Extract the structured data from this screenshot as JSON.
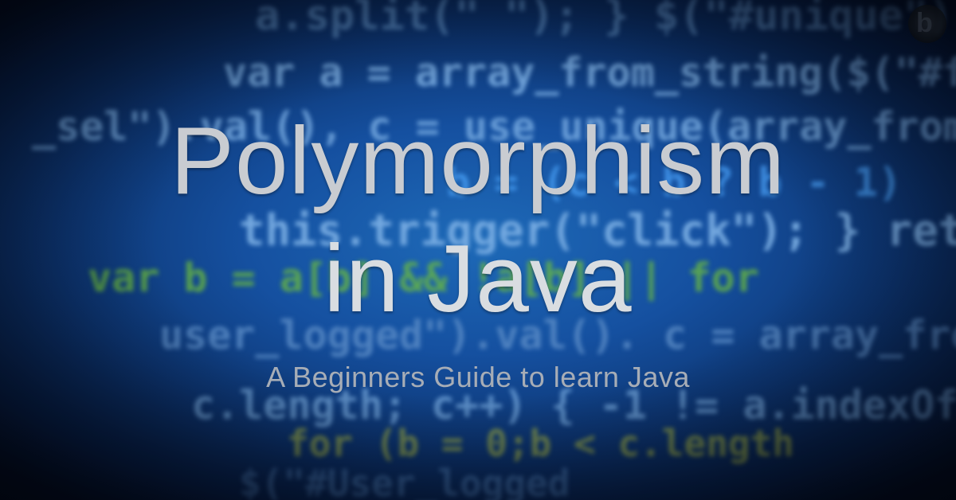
{
  "banner": {
    "title_line1": "Polymorphism",
    "title_line2": "in Java",
    "subtitle": "A Beginners Guide to learn Java"
  },
  "background": {
    "code_lines": [
      "a.split(\" \"); } $(\"#unique\").",
      "var a = array_from_string($(\"#fin\").",
      "_sel\").val(), c = use_unique(array_from_s",
      "b = (c < b ? b - 1)",
      "this.trigger(\"click\"); } return",
      "var b = a[b] && !a[b] || for",
      "user_logged\").val(). c = array_from_",
      "c.length; c++) { -1 != a.indexOf",
      "for (b = 0;b < c.length",
      "$(\"#User_logged"
    ],
    "colors": {
      "base": "#1550a0",
      "code": "#7fb2e6",
      "keyword": "#4fa8ff",
      "green": "#6fbf3a",
      "yellow": "#c9d23a"
    }
  },
  "logo": {
    "icon": "b-logo-icon"
  }
}
